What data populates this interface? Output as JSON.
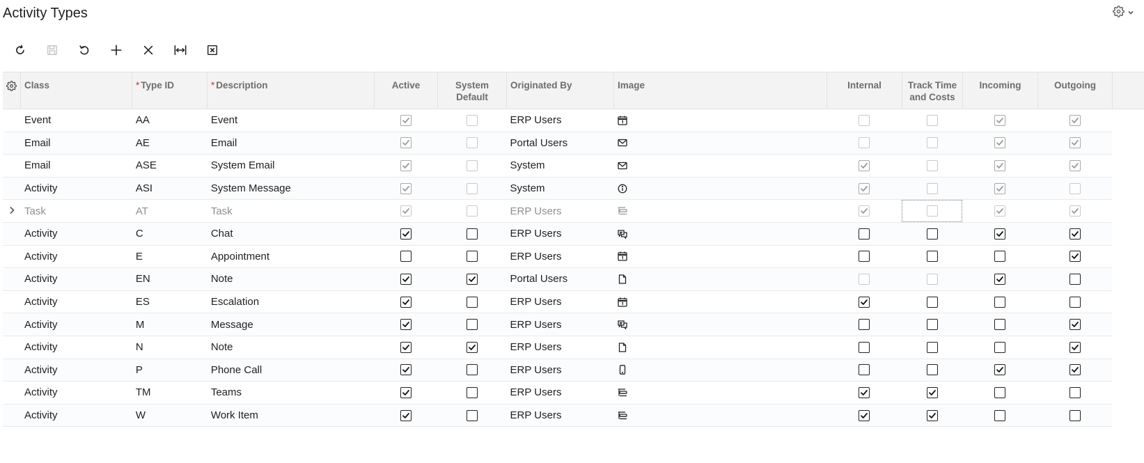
{
  "page": {
    "title": "Activity Types"
  },
  "header_settings": {
    "icon": "gear-icon",
    "chevron": "chevron-down-icon"
  },
  "toolbar": {
    "buttons": [
      {
        "name": "refresh",
        "icon": "refresh-icon",
        "enabled": true
      },
      {
        "name": "save",
        "icon": "save-icon",
        "enabled": false
      },
      {
        "name": "undo",
        "icon": "undo-icon",
        "enabled": true
      },
      {
        "name": "add",
        "icon": "plus-icon",
        "enabled": true
      },
      {
        "name": "delete",
        "icon": "close-icon",
        "enabled": true
      },
      {
        "name": "fit-columns",
        "icon": "fit-width-icon",
        "enabled": true
      },
      {
        "name": "export-excel",
        "icon": "excel-icon",
        "enabled": true
      }
    ]
  },
  "grid": {
    "columns": {
      "class": "Class",
      "type_id": "Type ID",
      "description": "Description",
      "active": "Active",
      "system_default": "System Default",
      "originated_by": "Originated By",
      "image": "Image",
      "internal": "Internal",
      "track_time": "Track Time and Costs",
      "incoming": "Incoming",
      "outgoing": "Outgoing"
    },
    "required_marker": "*",
    "rows": [
      {
        "class": "Event",
        "type_id": "AA",
        "description": "Event",
        "active": true,
        "system_default": false,
        "originated_by": "ERP Users",
        "image": "calendar-icon",
        "internal": false,
        "track_time": false,
        "incoming": true,
        "outgoing": true,
        "readonly": true
      },
      {
        "class": "Email",
        "type_id": "AE",
        "description": "Email",
        "active": true,
        "system_default": false,
        "originated_by": "Portal Users",
        "image": "envelope-icon",
        "internal": false,
        "track_time": false,
        "incoming": true,
        "outgoing": true,
        "readonly": true
      },
      {
        "class": "Email",
        "type_id": "ASE",
        "description": "System Email",
        "active": true,
        "system_default": false,
        "originated_by": "System",
        "image": "envelope-icon",
        "internal": true,
        "track_time": false,
        "incoming": true,
        "outgoing": true,
        "readonly": true
      },
      {
        "class": "Activity",
        "type_id": "ASI",
        "description": "System Message",
        "active": true,
        "system_default": false,
        "originated_by": "System",
        "image": "info-icon",
        "internal": true,
        "track_time": false,
        "incoming": true,
        "outgoing": false,
        "readonly": true
      },
      {
        "class": "Task",
        "type_id": "AT",
        "description": "Task",
        "active": true,
        "system_default": false,
        "originated_by": "ERP Users",
        "image": "task-icon",
        "internal": true,
        "track_time": false,
        "incoming": true,
        "outgoing": true,
        "readonly": true,
        "current": true
      },
      {
        "class": "Activity",
        "type_id": "C",
        "description": "Chat",
        "active": true,
        "system_default": false,
        "originated_by": "ERP Users",
        "image": "chat-icon",
        "internal": false,
        "track_time": false,
        "incoming": true,
        "outgoing": true
      },
      {
        "class": "Activity",
        "type_id": "E",
        "description": "Appointment",
        "active": false,
        "system_default": false,
        "originated_by": "ERP Users",
        "image": "calendar-icon",
        "internal": false,
        "track_time": false,
        "incoming": false,
        "outgoing": true
      },
      {
        "class": "Activity",
        "type_id": "EN",
        "description": "Note",
        "active": true,
        "system_default": true,
        "originated_by": "Portal Users",
        "image": "document-icon",
        "internal": false,
        "track_time": false,
        "incoming": true,
        "outgoing": false,
        "ro_internal": true
      },
      {
        "class": "Activity",
        "type_id": "ES",
        "description": "Escalation",
        "active": true,
        "system_default": false,
        "originated_by": "ERP Users",
        "image": "calendar-icon",
        "internal": true,
        "track_time": false,
        "incoming": false,
        "outgoing": false
      },
      {
        "class": "Activity",
        "type_id": "M",
        "description": "Message",
        "active": true,
        "system_default": false,
        "originated_by": "ERP Users",
        "image": "chat-icon",
        "internal": false,
        "track_time": false,
        "incoming": false,
        "outgoing": true
      },
      {
        "class": "Activity",
        "type_id": "N",
        "description": "Note",
        "active": true,
        "system_default": true,
        "originated_by": "ERP Users",
        "image": "document-icon",
        "internal": false,
        "track_time": false,
        "incoming": false,
        "outgoing": true
      },
      {
        "class": "Activity",
        "type_id": "P",
        "description": "Phone Call",
        "active": true,
        "system_default": false,
        "originated_by": "ERP Users",
        "image": "phone-icon",
        "internal": false,
        "track_time": false,
        "incoming": true,
        "outgoing": true
      },
      {
        "class": "Activity",
        "type_id": "TM",
        "description": "Teams",
        "active": true,
        "system_default": false,
        "originated_by": "ERP Users",
        "image": "task-icon",
        "internal": true,
        "track_time": true,
        "incoming": false,
        "outgoing": false
      },
      {
        "class": "Activity",
        "type_id": "W",
        "description": "Work Item",
        "active": true,
        "system_default": false,
        "originated_by": "ERP Users",
        "image": "task-icon",
        "internal": true,
        "track_time": true,
        "incoming": false,
        "outgoing": false
      }
    ]
  }
}
